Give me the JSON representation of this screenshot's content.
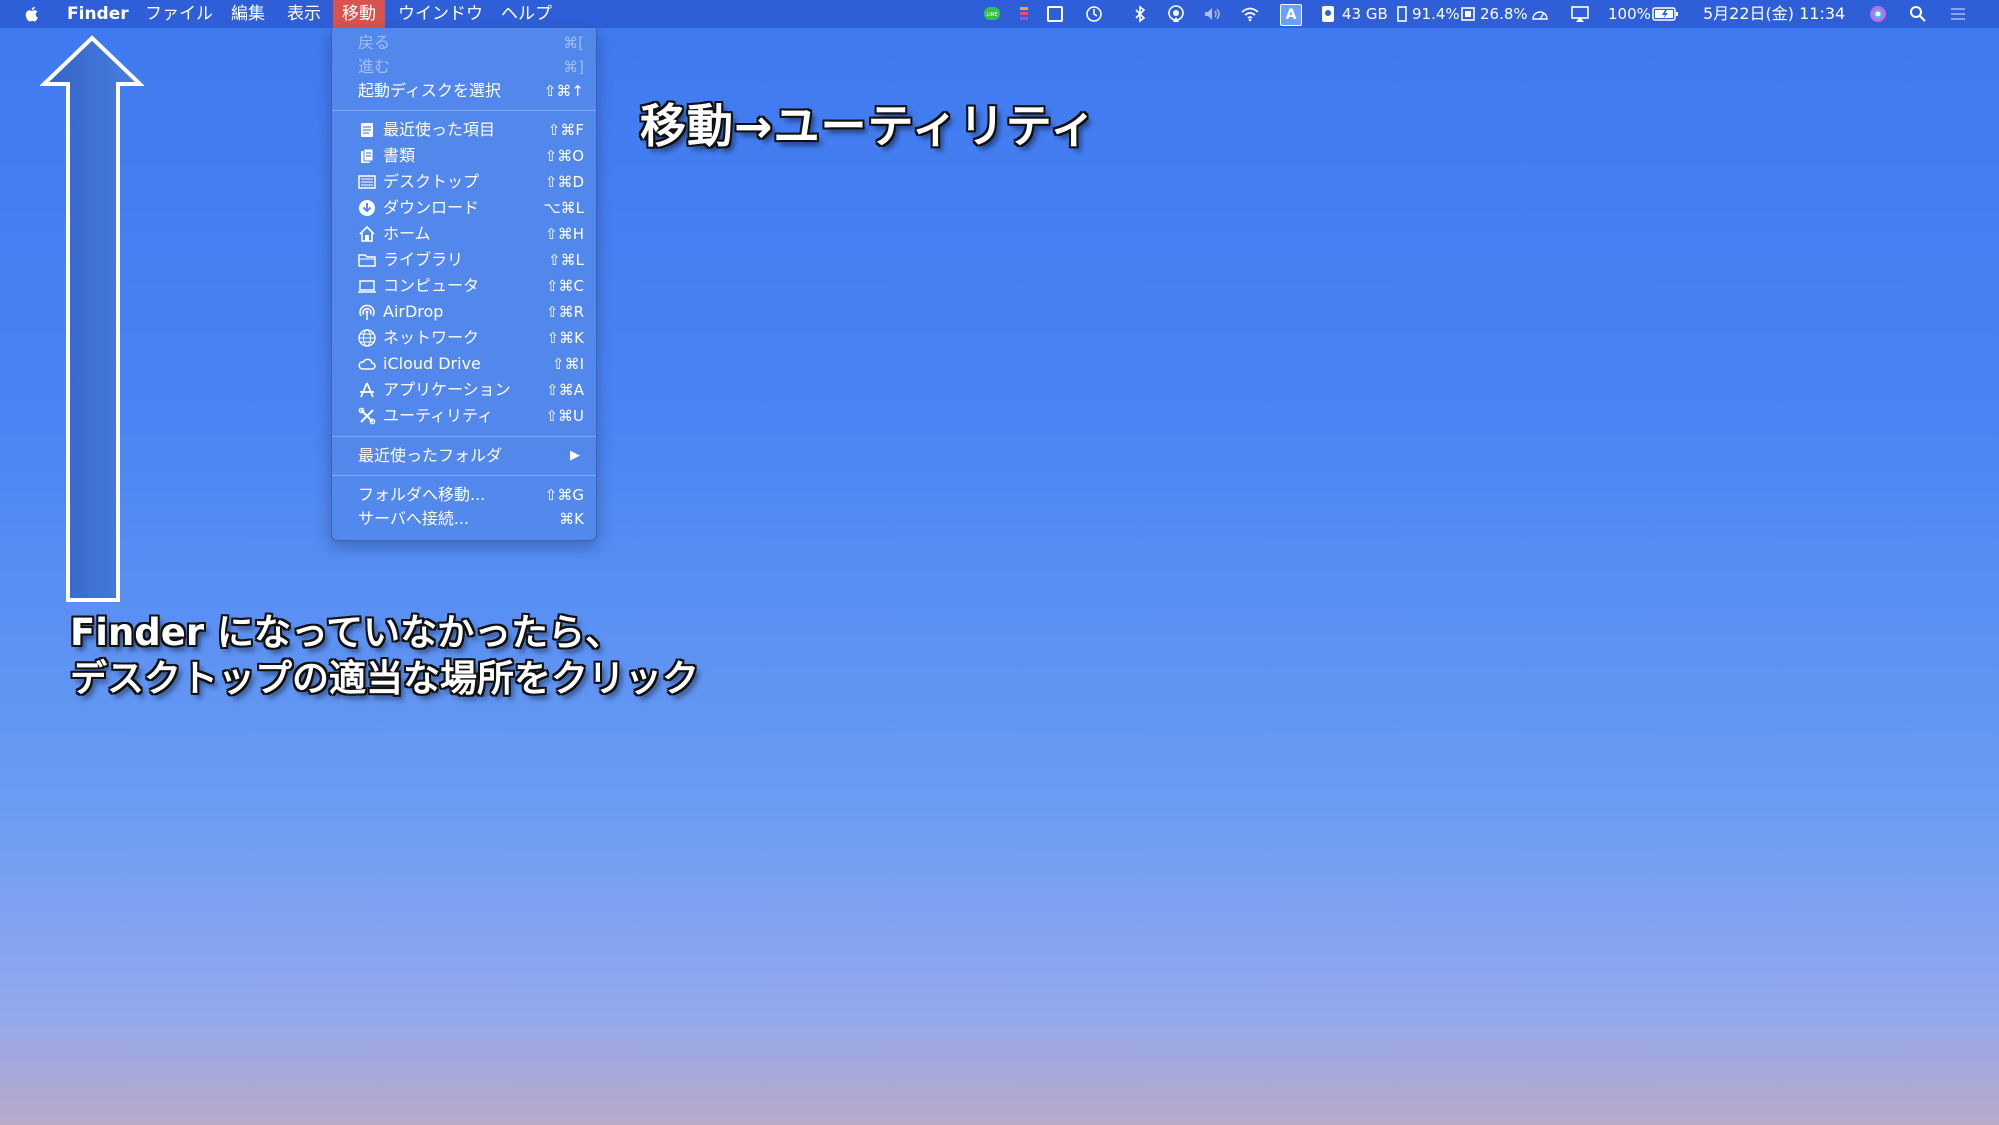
{
  "menubar": {
    "app_name": "Finder",
    "menus": [
      "ファイル",
      "編集",
      "表示",
      "移動",
      "ウインドウ",
      "ヘルプ"
    ],
    "active_menu": "移動",
    "status": {
      "storage": "43 GB",
      "cpu": "91.4%",
      "memory": "26.8%",
      "battery": "100%",
      "clock": "5月22日(金) 11:34",
      "input_method": "A"
    }
  },
  "go_menu": {
    "items_top": [
      {
        "label": "戻る",
        "shortcut": "⌘[",
        "disabled": true
      },
      {
        "label": "進む",
        "shortcut": "⌘]",
        "disabled": true
      },
      {
        "label": "起動ディスクを選択",
        "shortcut": "⇧⌘↑",
        "disabled": false
      }
    ],
    "places": [
      {
        "label": "最近使った項目",
        "shortcut": "⇧⌘F",
        "icon": "recents-icon"
      },
      {
        "label": "書類",
        "shortcut": "⇧⌘O",
        "icon": "documents-icon"
      },
      {
        "label": "デスクトップ",
        "shortcut": "⇧⌘D",
        "icon": "desktop-icon"
      },
      {
        "label": "ダウンロード",
        "shortcut": "⌥⌘L",
        "icon": "downloads-icon"
      },
      {
        "label": "ホーム",
        "shortcut": "⇧⌘H",
        "icon": "home-icon"
      },
      {
        "label": "ライブラリ",
        "shortcut": "⇧⌘L",
        "icon": "folder-icon"
      },
      {
        "label": "コンピュータ",
        "shortcut": "⇧⌘C",
        "icon": "computer-icon"
      },
      {
        "label": "AirDrop",
        "shortcut": "⇧⌘R",
        "icon": "airdrop-icon"
      },
      {
        "label": "ネットワーク",
        "shortcut": "⇧⌘K",
        "icon": "network-icon"
      },
      {
        "label": "iCloud Drive",
        "shortcut": "⇧⌘I",
        "icon": "icloud-icon"
      },
      {
        "label": "アプリケーション",
        "shortcut": "⇧⌘A",
        "icon": "applications-icon"
      },
      {
        "label": "ユーティリティ",
        "shortcut": "⇧⌘U",
        "icon": "utilities-icon"
      }
    ],
    "recent_folders": "最近使ったフォルダ",
    "items_bottom": [
      {
        "label": "フォルダへ移動...",
        "shortcut": "⇧⌘G"
      },
      {
        "label": "サーバへ接続...",
        "shortcut": "⌘K"
      }
    ]
  },
  "annotations": {
    "title": "移動→ユーティリティ",
    "hint_line1": "Finder になっていなかったら、",
    "hint_line2": "デスクトップの適当な場所をクリック"
  },
  "colors": {
    "menubar": "#2f5fd8",
    "active_menu": "#d9534f",
    "desktop_top": "#3f79f0",
    "arrow_fill": "#3d6fd3"
  }
}
